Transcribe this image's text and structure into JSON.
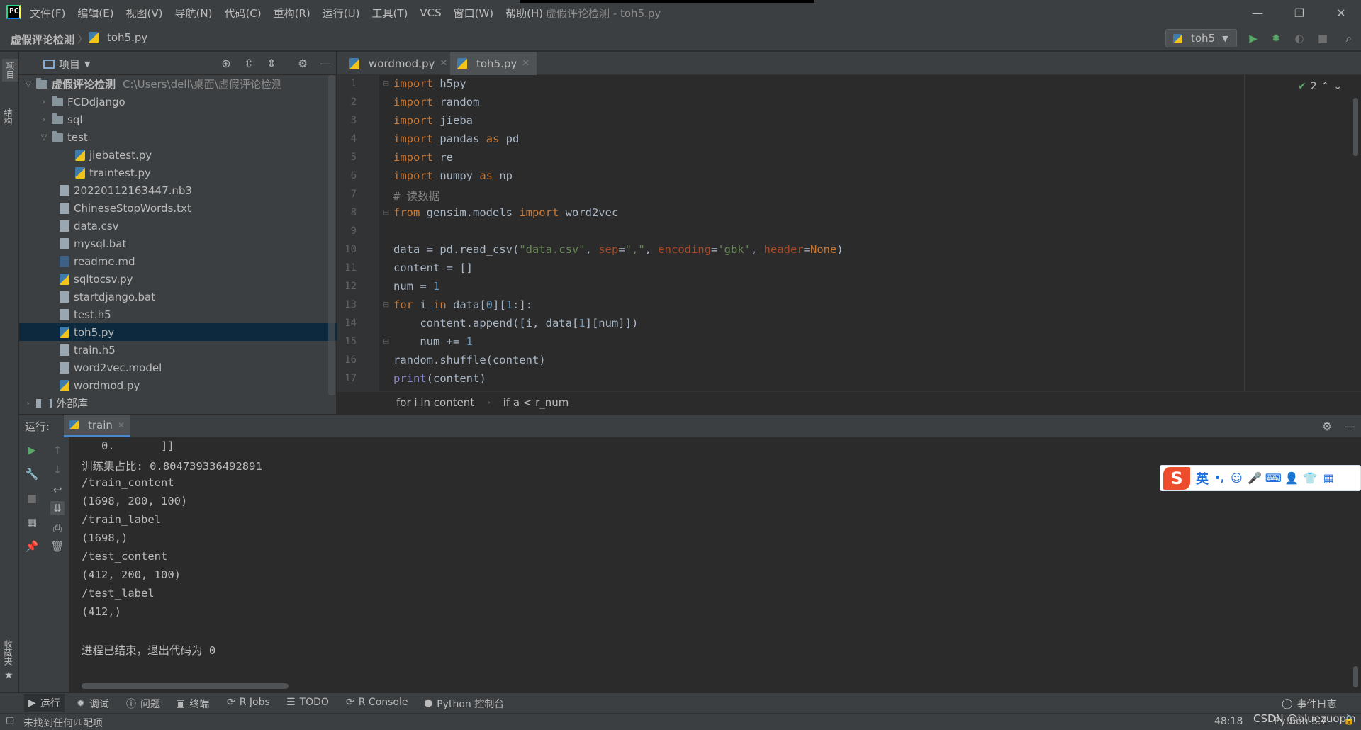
{
  "window": {
    "title": "虚假评论检测 - toh5.py",
    "menu": [
      "文件(F)",
      "编辑(E)",
      "视图(V)",
      "导航(N)",
      "代码(C)",
      "重构(R)",
      "运行(U)",
      "工具(T)",
      "VCS",
      "窗口(W)",
      "帮助(H)"
    ],
    "minimize": "—",
    "restore": "❐",
    "close": "✕"
  },
  "navbar": {
    "project": "虚假评论检测",
    "separator": "〉",
    "file": "toh5.py",
    "run_config": "toh5"
  },
  "left_strip": {
    "project_tab": "项目",
    "structure_tab": "结构",
    "favorites_tab": "收藏夹"
  },
  "project_panel": {
    "title": "项目",
    "root": {
      "name": "虚假评论检测",
      "path": "C:\\Users\\dell\\桌面\\虚假评论检测"
    },
    "items": [
      {
        "label": "FCDdjango",
        "kind": "folder",
        "expanded": false
      },
      {
        "label": "sql",
        "kind": "folder",
        "expanded": false
      },
      {
        "label": "test",
        "kind": "folder",
        "expanded": true
      },
      {
        "label": "jiebatest.py",
        "kind": "py"
      },
      {
        "label": "traintest.py",
        "kind": "py"
      },
      {
        "label": "20220112163447.nb3",
        "kind": "gen"
      },
      {
        "label": "ChineseStopWords.txt",
        "kind": "gen"
      },
      {
        "label": "data.csv",
        "kind": "gen"
      },
      {
        "label": "mysql.bat",
        "kind": "gen"
      },
      {
        "label": "readme.md",
        "kind": "md"
      },
      {
        "label": "sqltocsv.py",
        "kind": "py"
      },
      {
        "label": "startdjango.bat",
        "kind": "gen"
      },
      {
        "label": "test.h5",
        "kind": "gen"
      },
      {
        "label": "toh5.py",
        "kind": "py",
        "selected": true
      },
      {
        "label": "train.h5",
        "kind": "gen"
      },
      {
        "label": "word2vec.model",
        "kind": "gen"
      },
      {
        "label": "wordmod.py",
        "kind": "py"
      },
      {
        "label": "外部库",
        "kind": "lib",
        "expanded": false
      }
    ]
  },
  "editor": {
    "tabs": [
      {
        "label": "wordmod.py",
        "active": false
      },
      {
        "label": "toh5.py",
        "active": true
      }
    ],
    "line_numbers": [
      "1",
      "2",
      "3",
      "4",
      "5",
      "6",
      "7",
      "8",
      "9",
      "10",
      "11",
      "12",
      "13",
      "14",
      "15",
      "16",
      "17"
    ],
    "inspections_count": "2",
    "breadcrumbs": [
      "for i in content",
      "if a < r_num"
    ]
  },
  "run_panel": {
    "label": "运行:",
    "tab": "train",
    "output": [
      "   0.       ]]",
      "训练集占比: 0.804739336492891",
      "/train_content",
      "(1698, 200, 100)",
      "/train_label",
      "(1698,)",
      "/test_content",
      "(412, 200, 100)",
      "/test_label",
      "(412,)",
      "",
      "进程已结束，退出代码为 0"
    ]
  },
  "ime": {
    "mode": "英",
    "punct": "•,"
  },
  "bottom_tabs": [
    "运行",
    "调试",
    "问题",
    "终端",
    "R Jobs",
    "TODO",
    "R Console",
    "Python 控制台"
  ],
  "event_log": "事件日志",
  "status": {
    "message": "未找到任何匹配项",
    "position": "48:18",
    "interpreter": "Python 3.7",
    "watermark": "CSDN @bluezuopin"
  },
  "colors": {
    "accent": "#4a88c7",
    "run_green": "#59a869",
    "selection": "#0d293e",
    "keyword": "#cc7832",
    "string": "#6a8759",
    "number": "#6897bb"
  }
}
